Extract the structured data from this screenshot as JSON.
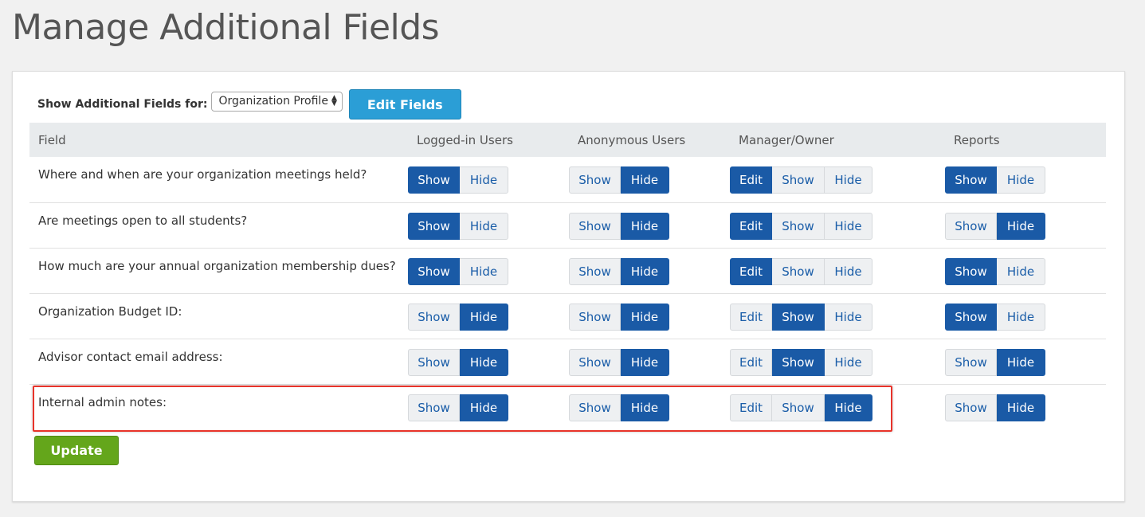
{
  "page": {
    "title": "Manage Additional Fields"
  },
  "toolbar": {
    "label": "Show Additional Fields for:",
    "select_value": "Organization Profile",
    "edit_fields_label": "Edit Fields"
  },
  "table": {
    "columns": [
      "Field",
      "Logged-in Users",
      "Anonymous Users",
      "Manager/Owner",
      "Reports"
    ],
    "rows": [
      {
        "field": "Where and when are your organization meetings held?",
        "logged_in": "Show",
        "anonymous": "Hide",
        "manager": "Edit",
        "reports": "Show"
      },
      {
        "field": "Are meetings open to all students?",
        "logged_in": "Show",
        "anonymous": "Hide",
        "manager": "Edit",
        "reports": "Hide"
      },
      {
        "field": "How much are your annual organization membership dues?",
        "logged_in": "Show",
        "anonymous": "Hide",
        "manager": "Edit",
        "reports": "Show"
      },
      {
        "field": "Organization Budget ID:",
        "logged_in": "Hide",
        "anonymous": "Hide",
        "manager": "Show",
        "reports": "Show"
      },
      {
        "field": "Advisor contact email address:",
        "logged_in": "Hide",
        "anonymous": "Hide",
        "manager": "Show",
        "reports": "Hide"
      },
      {
        "field": "Internal admin notes:",
        "logged_in": "Hide",
        "anonymous": "Hide",
        "manager": "Hide",
        "reports": "Hide"
      }
    ],
    "highlighted_row": 5
  },
  "options": {
    "visibility": [
      "Show",
      "Hide"
    ],
    "manager": [
      "Edit",
      "Show",
      "Hide"
    ]
  },
  "actions": {
    "update_label": "Update"
  },
  "colors": {
    "active_button": "#1a5aa6",
    "inactive_button": "#eef0f2",
    "edit_fields_button": "#2b9ed6",
    "update_button": "#64a61b",
    "highlight_border": "#e8332a",
    "header_row": "#e8ebed"
  }
}
